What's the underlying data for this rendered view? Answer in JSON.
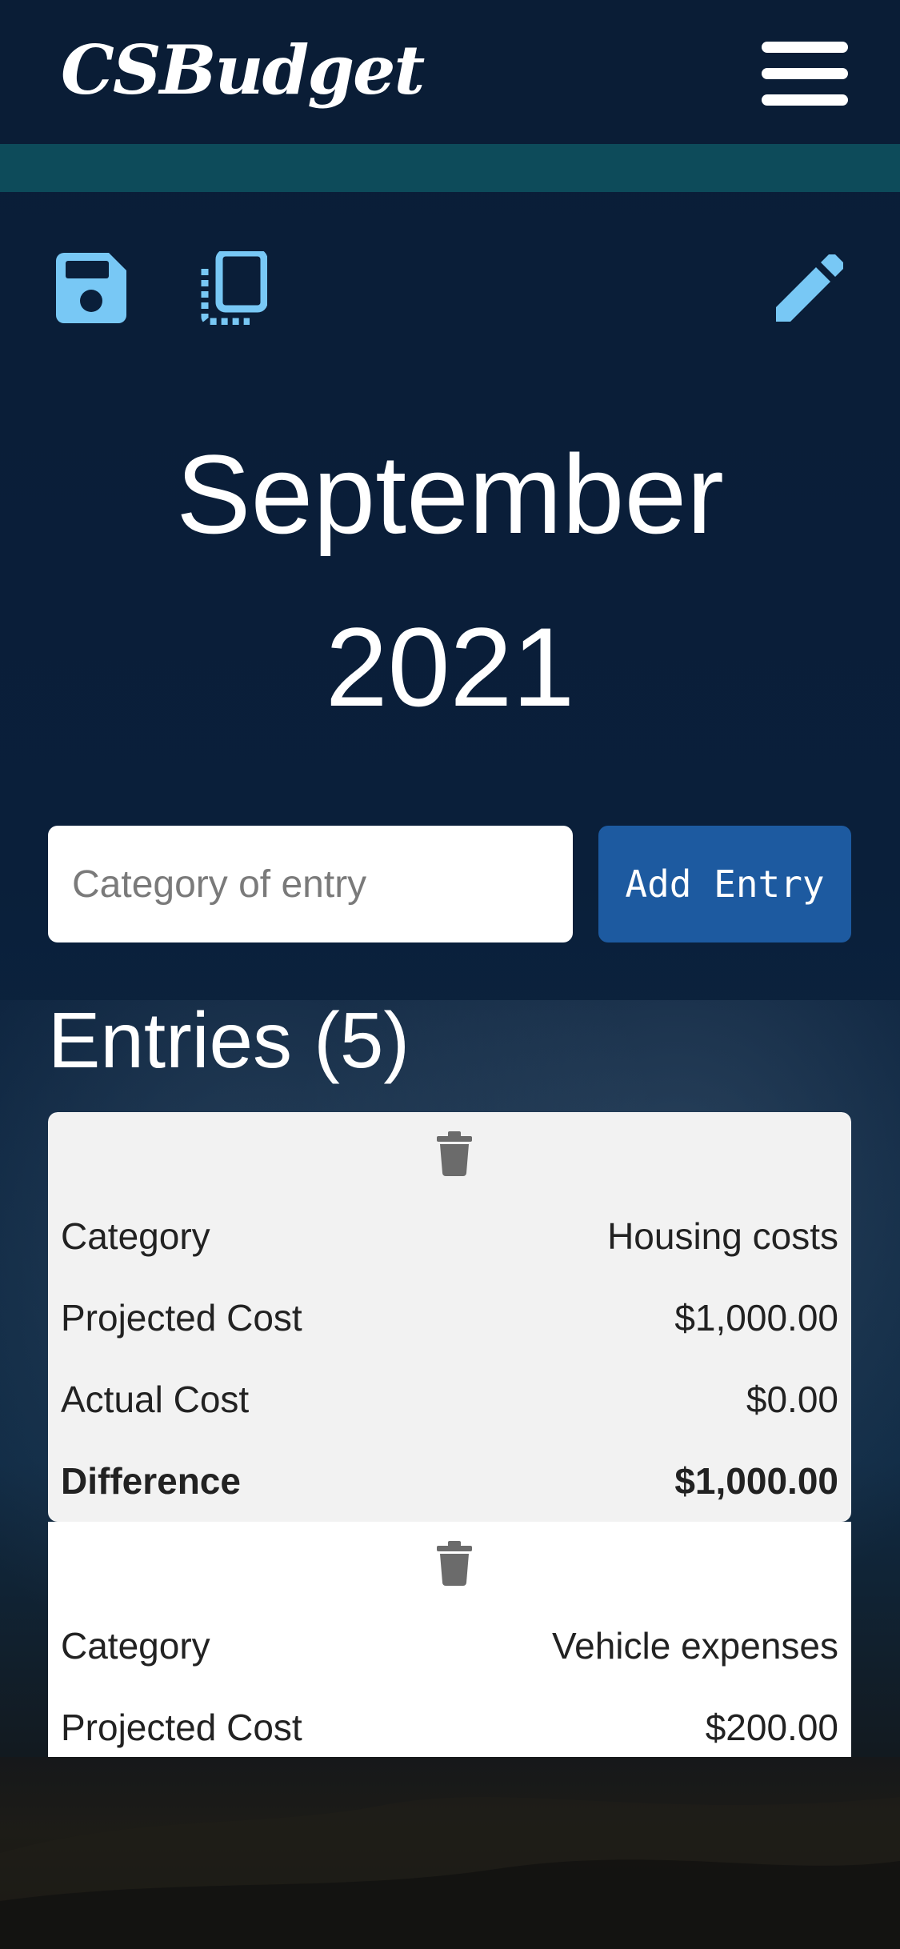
{
  "app": {
    "brand": "CSBudget"
  },
  "toolbar": {
    "save_icon": "save-icon",
    "copy_icon": "copy-icon",
    "edit_icon": "edit-icon",
    "icon_color": "#78c8f5"
  },
  "page": {
    "month": "September",
    "year": "2021"
  },
  "add_entry": {
    "placeholder": "Category of entry",
    "button_label": "Add Entry"
  },
  "entries": {
    "heading": "Entries (5)",
    "items": [
      {
        "labels": {
          "category": "Category",
          "projected": "Projected Cost",
          "actual": "Actual Cost",
          "difference": "Difference"
        },
        "category": "Housing costs",
        "projected": "$1,000.00",
        "actual": "$0.00",
        "difference": "$1,000.00"
      },
      {
        "labels": {
          "category": "Category",
          "projected": "Projected Cost"
        },
        "category": "Vehicle expenses",
        "projected": "$200.00"
      }
    ]
  },
  "colors": {
    "navbar": "#0a1d36",
    "accent_strip": "#0d4b5a",
    "button": "#1d5aa0",
    "trash": "#6b6b6b"
  }
}
